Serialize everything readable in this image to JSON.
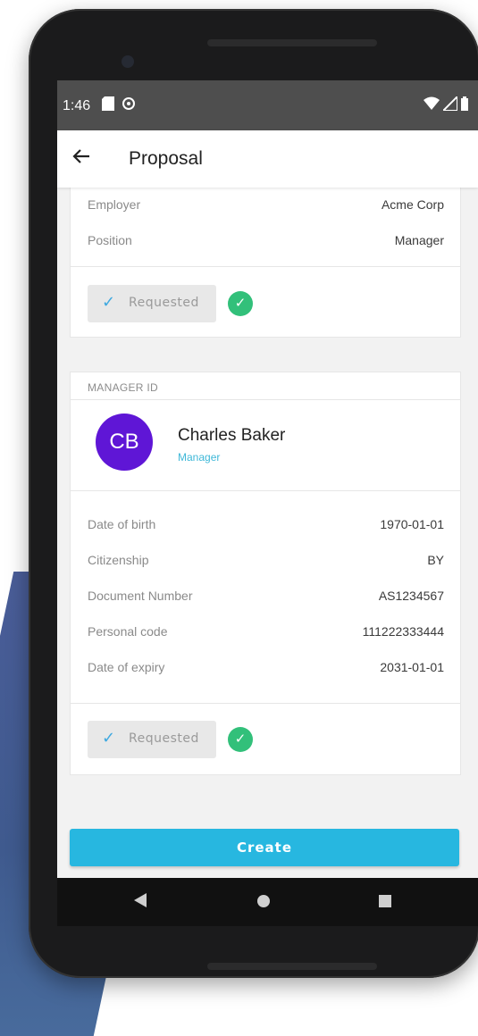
{
  "status_bar": {
    "time": "1:46"
  },
  "app_bar": {
    "title": "Proposal"
  },
  "employer_card": {
    "rows": [
      {
        "label": "Employer",
        "value": "Acme Corp"
      },
      {
        "label": "Position",
        "value": "Manager"
      }
    ],
    "request_label": "Requested"
  },
  "manager_card": {
    "section_title": "MANAGER ID",
    "avatar_initials": "CB",
    "name": "Charles Baker",
    "role": "Manager",
    "rows": [
      {
        "label": "Date of birth",
        "value": "1970-01-01"
      },
      {
        "label": "Citizenship",
        "value": "BY"
      },
      {
        "label": "Document Number",
        "value": "AS1234567"
      },
      {
        "label": "Personal code",
        "value": "111222333444"
      },
      {
        "label": "Date of expiry",
        "value": "2031-01-01"
      }
    ],
    "request_label": "Requested"
  },
  "create_button": {
    "label": "Create"
  },
  "colors": {
    "accent": "#27b7e0",
    "avatar": "#5f16d6",
    "success": "#32c07a",
    "role_text": "#3fb8d8"
  },
  "icons": {
    "back": "arrow-left-icon",
    "check": "checkmark-icon",
    "nav_back": "triangle-back-icon",
    "nav_home": "circle-home-icon",
    "nav_recents": "square-recents-icon"
  }
}
